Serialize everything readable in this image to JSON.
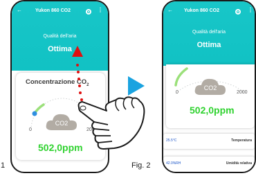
{
  "phone1": {
    "title": "Yukon 860 CO2",
    "quality_label": "Qualità dell'aria",
    "quality_value": "Ottima",
    "card_title": "Concentrazione CO",
    "card_title_sub": "2",
    "tick_min": "0",
    "tick_max": "2000",
    "co2_label": "CO2",
    "reading": "502,0ppm"
  },
  "phone2": {
    "title": "Yukon 860 CO2",
    "quality_label": "Qualità dell'aria",
    "quality_value": "Ottima",
    "tick_min": "0",
    "tick_max": "2000",
    "co2_label": "CO2",
    "reading": "502,0ppm",
    "rows": [
      {
        "value": "25.5°C",
        "label": "Temperatura"
      },
      {
        "value": "42.0%RH",
        "label": "Umidità relativa"
      }
    ]
  },
  "figure_labels": {
    "fig1_partial": "1",
    "fig2": "Fig. 2"
  },
  "colors": {
    "header": "#11c2c4",
    "accent_green": "#2fd22f",
    "arrow_red": "#e01010",
    "play_blue": "#1aa3e0",
    "row_value_blue": "#1a54c8"
  },
  "icons": [
    "back-arrow-icon",
    "gear-icon",
    "kebab-menu-icon",
    "cloud-icon",
    "hand-pointer-icon",
    "swipe-up-arrow-icon",
    "play-triangle-icon"
  ]
}
